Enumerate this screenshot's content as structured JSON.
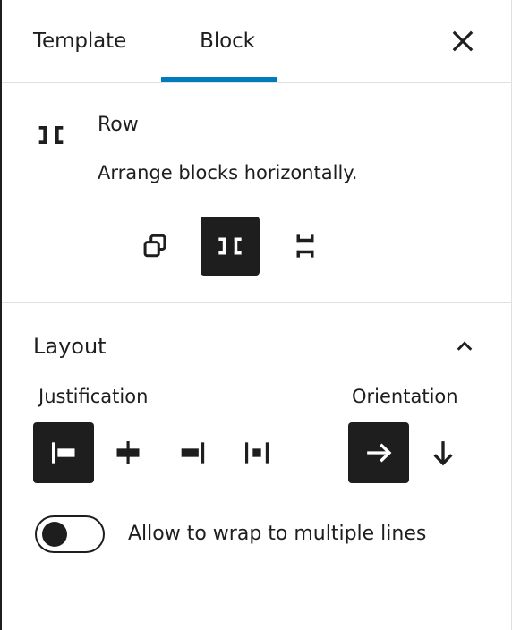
{
  "window": {
    "accent_color": "#007cba",
    "selected_bg": "#1e1e1e",
    "border_color": "#e0e0e0"
  },
  "tabs": {
    "items": [
      {
        "label": "Template",
        "selected": false
      },
      {
        "label": "Block",
        "selected": true
      }
    ],
    "close_label": "Close Settings"
  },
  "block_card": {
    "icon": "row-icon",
    "title": "Row",
    "description": "Arrange blocks horizontally.",
    "variations": [
      {
        "name": "Group",
        "icon": "group-icon",
        "selected": false
      },
      {
        "name": "Row",
        "icon": "row-icon",
        "selected": true
      },
      {
        "name": "Stack",
        "icon": "stack-icon",
        "selected": false
      }
    ]
  },
  "layout_panel": {
    "title": "Layout",
    "expanded": true,
    "chevron": "chevron-up-icon",
    "justification": {
      "label": "Justification",
      "options": [
        {
          "name": "Justify items left",
          "icon": "justify-left-icon",
          "selected": true
        },
        {
          "name": "Justify items center",
          "icon": "justify-center-icon",
          "selected": false
        },
        {
          "name": "Justify items right",
          "icon": "justify-right-icon",
          "selected": false
        },
        {
          "name": "Space between items",
          "icon": "justify-space-between-icon",
          "selected": false
        }
      ]
    },
    "orientation": {
      "label": "Orientation",
      "options": [
        {
          "name": "Horizontal",
          "icon": "arrow-right-icon",
          "selected": true
        },
        {
          "name": "Vertical",
          "icon": "arrow-down-icon",
          "selected": false
        }
      ]
    },
    "wrap_toggle": {
      "label": "Allow to wrap to multiple lines",
      "checked": false
    }
  }
}
